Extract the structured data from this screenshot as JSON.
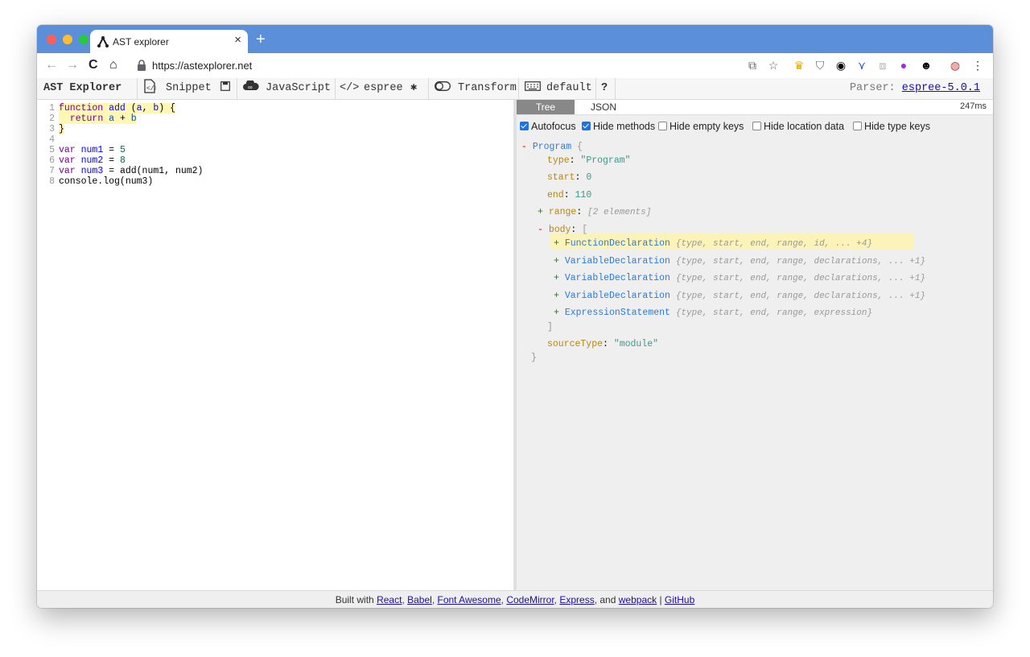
{
  "browser": {
    "tab_title": "AST explorer",
    "tab_close": "×",
    "new_tab": "+",
    "url": "https://astexplorer.net",
    "nav": {
      "back": "←",
      "forward": "→",
      "reload": "C",
      "home": "⌂"
    }
  },
  "toolbar": {
    "brand": "AST Explorer",
    "snippet": "Snippet",
    "language": "JavaScript",
    "parser_name": "espree",
    "transform": "Transform",
    "keymap": "default",
    "help": "?",
    "parser_label": "Parser:",
    "parser_version": "espree-5.0.1"
  },
  "editor": {
    "lines": [
      {
        "n": "1",
        "code": "function add (a, b) {"
      },
      {
        "n": "2",
        "code": "  return a + b"
      },
      {
        "n": "3",
        "code": "}"
      },
      {
        "n": "4",
        "code": ""
      },
      {
        "n": "5",
        "code": "var num1 = 5"
      },
      {
        "n": "6",
        "code": "var num2 = 8"
      },
      {
        "n": "7",
        "code": "var num3 = add(num1, num2)"
      },
      {
        "n": "8",
        "code": "console.log(num3)"
      }
    ]
  },
  "output": {
    "tabs": [
      "Tree",
      "JSON"
    ],
    "active_tab": "Tree",
    "time": "247ms",
    "options": [
      {
        "label": "Autofocus",
        "checked": true
      },
      {
        "label": "Hide methods",
        "checked": true
      },
      {
        "label": "Hide empty keys",
        "checked": false
      },
      {
        "label": "Hide location data",
        "checked": false
      },
      {
        "label": "Hide type keys",
        "checked": false
      }
    ],
    "tree": {
      "root_name": "Program",
      "root_open": "{",
      "root_close": "}",
      "type_key": "type",
      "type_val": "\"Program\"",
      "start_key": "start",
      "start_val": "0",
      "end_key": "end",
      "end_val": "110",
      "range_key": "range",
      "range_summary": "[2 elements]",
      "body_key": "body",
      "body_open": "[",
      "body_close": "]",
      "body_items": [
        {
          "name": "FunctionDeclaration",
          "summary": "{type, start, end, range, id, ... +4}"
        },
        {
          "name": "VariableDeclaration",
          "summary": "{type, start, end, range, declarations, ... +1}"
        },
        {
          "name": "VariableDeclaration",
          "summary": "{type, start, end, range, declarations, ... +1}"
        },
        {
          "name": "VariableDeclaration",
          "summary": "{type, start, end, range, declarations, ... +1}"
        },
        {
          "name": "ExpressionStatement",
          "summary": "{type, start, end, range, expression}"
        }
      ],
      "source_key": "sourceType",
      "source_val": "\"module\""
    }
  },
  "footer": {
    "prefix": "Built with",
    "links": [
      "React",
      "Babel",
      "Font Awesome",
      "CodeMirror",
      "Express",
      "webpack",
      "GitHub"
    ],
    "and": "and"
  }
}
